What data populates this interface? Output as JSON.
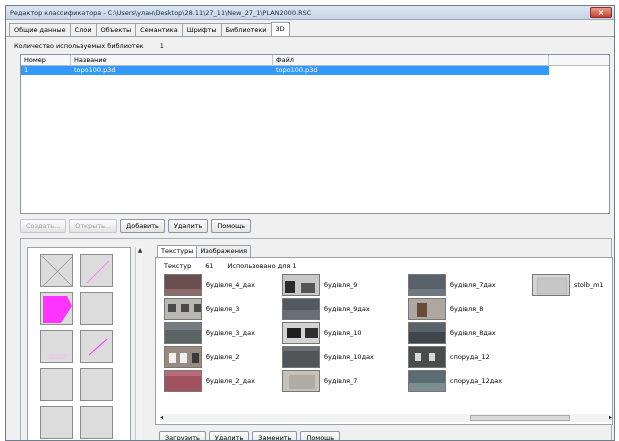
{
  "window": {
    "title": "Редактор классификатора - C:\\Users\\улан\\Desktop\\28.11\\27_11\\New_27_1\\PLAN2000.RSC",
    "close_label": "×"
  },
  "tabs": [
    {
      "label": "Общие данные"
    },
    {
      "label": "Слои"
    },
    {
      "label": "Объекты"
    },
    {
      "label": "Семантика"
    },
    {
      "label": "Шрифты"
    },
    {
      "label": "Библиотеки"
    },
    {
      "label": "3D"
    }
  ],
  "libraries": {
    "count_label": "Количество используемых библиотек",
    "count_value": "1"
  },
  "table": {
    "columns": [
      "Номер",
      "Название",
      "Файл"
    ],
    "rows": [
      {
        "num": "1",
        "name": "topo100.p3d",
        "file": "topo100.p3d"
      }
    ]
  },
  "buttons": {
    "create": "Создать...",
    "open": "Открыть...",
    "add": "Добавить",
    "remove": "Удалить",
    "help": "Помощь"
  },
  "subtabs": [
    {
      "label": "Текстуры"
    },
    {
      "label": "Изображения"
    }
  ],
  "textures": {
    "count_label": "Текстур",
    "count_value": "61",
    "used_label": "Использовано для 1",
    "items": [
      {
        "label": "будівля_4_дах"
      },
      {
        "label": "будівля_3"
      },
      {
        "label": "будівля_3_дах"
      },
      {
        "label": "будівля_2"
      },
      {
        "label": "будівля_2_дах"
      },
      {
        "label": "будівля_9"
      },
      {
        "label": "будівля_9дах"
      },
      {
        "label": "будівля_10"
      },
      {
        "label": "будівля_10дах"
      },
      {
        "label": "будівля_7"
      },
      {
        "label": "будівля_7дах"
      },
      {
        "label": "будівля_8"
      },
      {
        "label": "будівля_8дах"
      },
      {
        "label": "споруда_12"
      },
      {
        "label": "споруда_12дах"
      },
      {
        "label": "stolb_m1"
      }
    ]
  },
  "bottom_buttons": {
    "load": "Загрузить",
    "delete": "Удалить",
    "replace": "Заменить",
    "help": "Помощь"
  },
  "colors": {
    "selection": "#3399ff",
    "magenta": "#ff33ff"
  }
}
